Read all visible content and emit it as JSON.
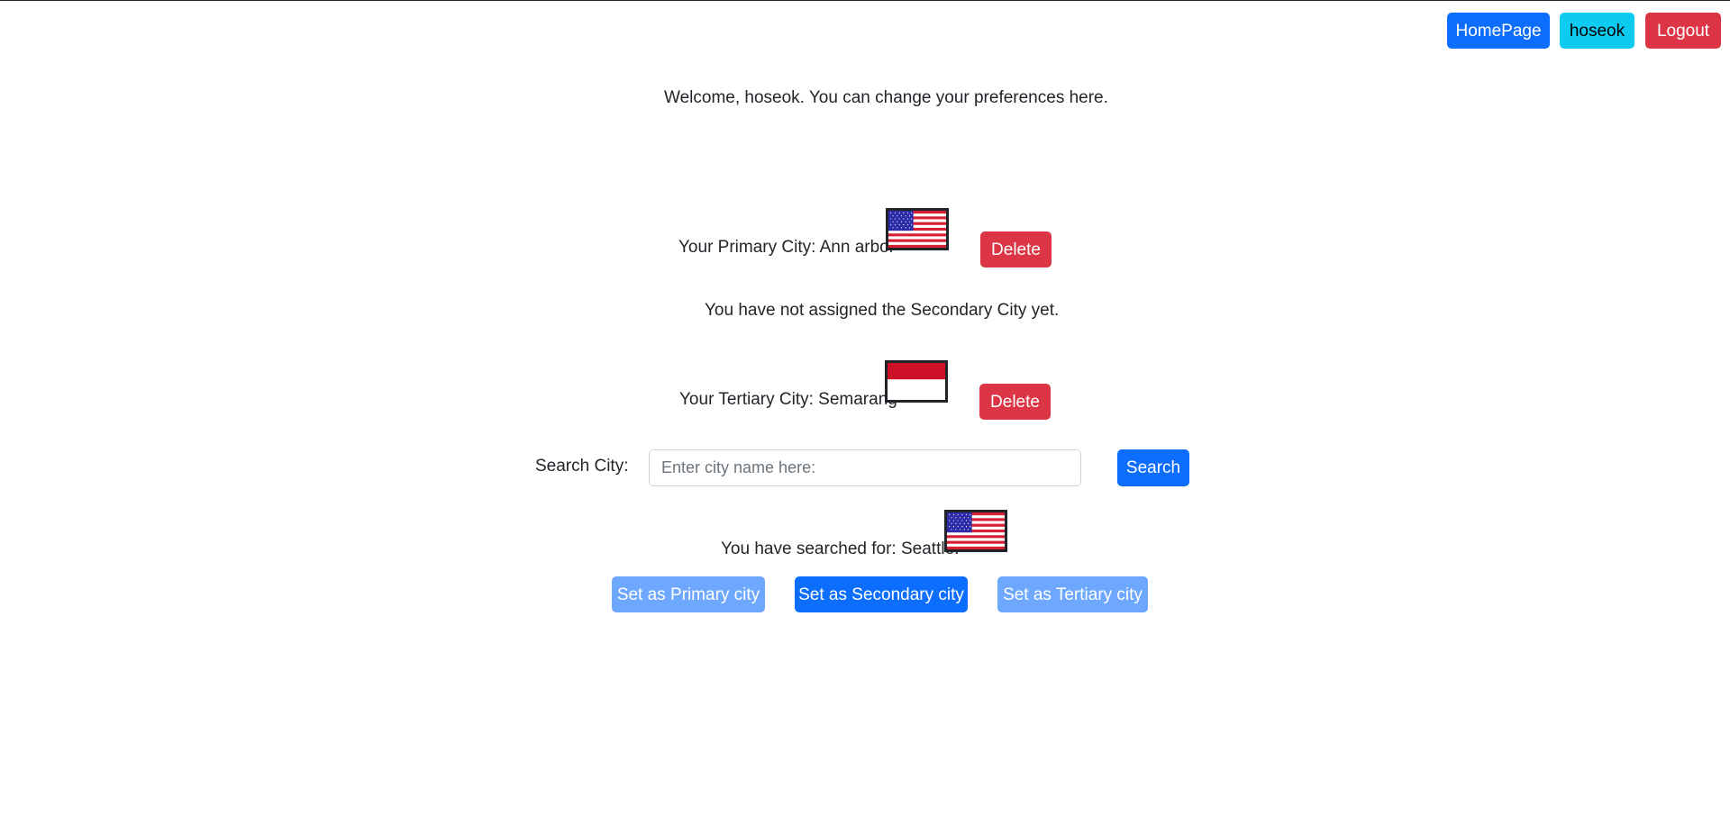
{
  "nav": {
    "homepage_label": "HomePage",
    "user_label": "hoseok",
    "logout_label": "Logout"
  },
  "welcome": {
    "message": "Welcome, hoseok. You can change your preferences here."
  },
  "cities": {
    "primary": {
      "text": "Your Primary City: Ann arbor",
      "flag": "us-flag-icon",
      "delete_label": "Delete"
    },
    "secondary": {
      "text": "You have not assigned the Secondary City yet."
    },
    "tertiary": {
      "text": "Your Tertiary City: Semarang",
      "flag": "indonesia-flag-icon",
      "delete_label": "Delete"
    }
  },
  "search": {
    "label": "Search City:",
    "placeholder": "Enter city name here:",
    "value": "",
    "button_label": "Search",
    "result_text": "You have searched for: Seattle.",
    "result_flag": "us-flag-icon"
  },
  "actions": {
    "set_primary_label": "Set as Primary city",
    "set_secondary_label": "Set as Secondary city",
    "set_tertiary_label": "Set as Tertiary city",
    "set_primary_enabled": false,
    "set_secondary_enabled": true,
    "set_tertiary_enabled": false
  },
  "colors": {
    "primary": "#0d6efd",
    "info": "#0dcaf0",
    "danger": "#dc3545",
    "disabled_primary": "#6ea8fe"
  }
}
